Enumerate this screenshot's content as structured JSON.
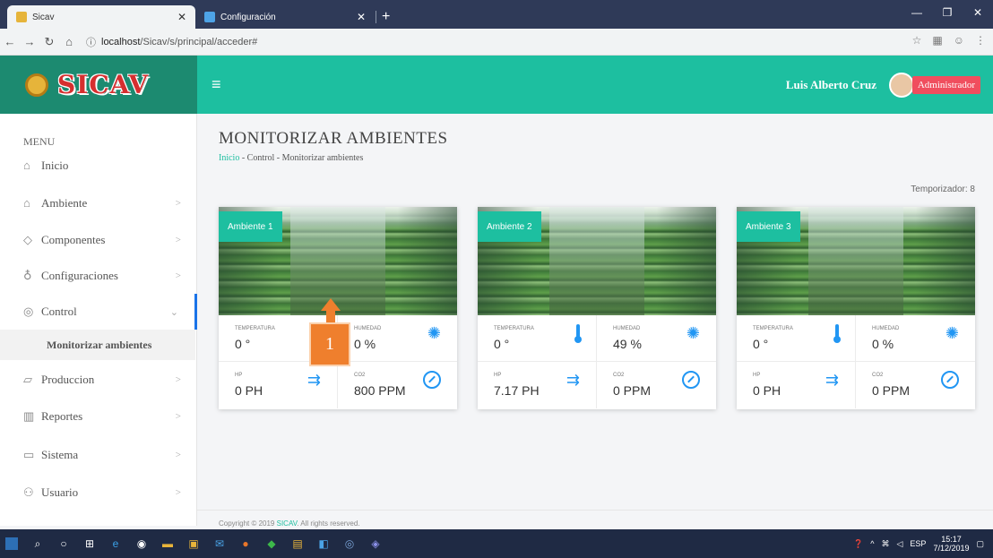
{
  "browser": {
    "tabs": [
      {
        "title": "Sicav"
      },
      {
        "title": "Configuración"
      }
    ],
    "url_host": "localhost",
    "url_path": "/Sicav/s/principal/acceder#"
  },
  "app": {
    "brand": "SICAV",
    "user_name": "Luis Alberto Cruz",
    "role": "Administrador"
  },
  "sidebar": {
    "menu_header": "MENU",
    "items": [
      {
        "label": "Inicio"
      },
      {
        "label": "Ambiente"
      },
      {
        "label": "Componentes"
      },
      {
        "label": "Configuraciones"
      },
      {
        "label": "Control"
      },
      {
        "label": "Produccion"
      },
      {
        "label": "Reportes"
      },
      {
        "label": "Sistema"
      },
      {
        "label": "Usuario"
      }
    ],
    "subitem": "Monitorizar ambientes"
  },
  "main": {
    "title": "MONITORIZAR AMBIENTES",
    "breadcrumb": {
      "home": "Inicio",
      "sep": "-",
      "mid": "Control",
      "current": "Monitorizar ambientes"
    },
    "timer": "Temporizador: 8",
    "cards": [
      {
        "name": "Ambiente 1",
        "temp_label": "TEMPERATURA",
        "temp": "0 °",
        "hum_label": "HUMEDAD",
        "hum": "0 %",
        "ph_label": "HP",
        "ph": "0 PH",
        "co2_label": "CO2",
        "co2": "800 PPM"
      },
      {
        "name": "Ambiente 2",
        "temp_label": "TEMPERATURA",
        "temp": "0 °",
        "hum_label": "HUMEDAD",
        "hum": "49 %",
        "ph_label": "HP",
        "ph": "7.17 PH",
        "co2_label": "CO2",
        "co2": "0 PPM"
      },
      {
        "name": "Ambiente 3",
        "temp_label": "TEMPERATURA",
        "temp": "0 °",
        "hum_label": "HUMEDAD",
        "hum": "0 %",
        "ph_label": "HP",
        "ph": "0 PH",
        "co2_label": "CO2",
        "co2": "0 PPM"
      }
    ]
  },
  "footer": {
    "prefix": "Copyright © 2019 ",
    "brand": "SICAV",
    "suffix": ". All rights reserved."
  },
  "annotation": {
    "label": "1"
  },
  "taskbar": {
    "lang": "ESP",
    "time": "15:17",
    "date": "7/12/2019"
  }
}
